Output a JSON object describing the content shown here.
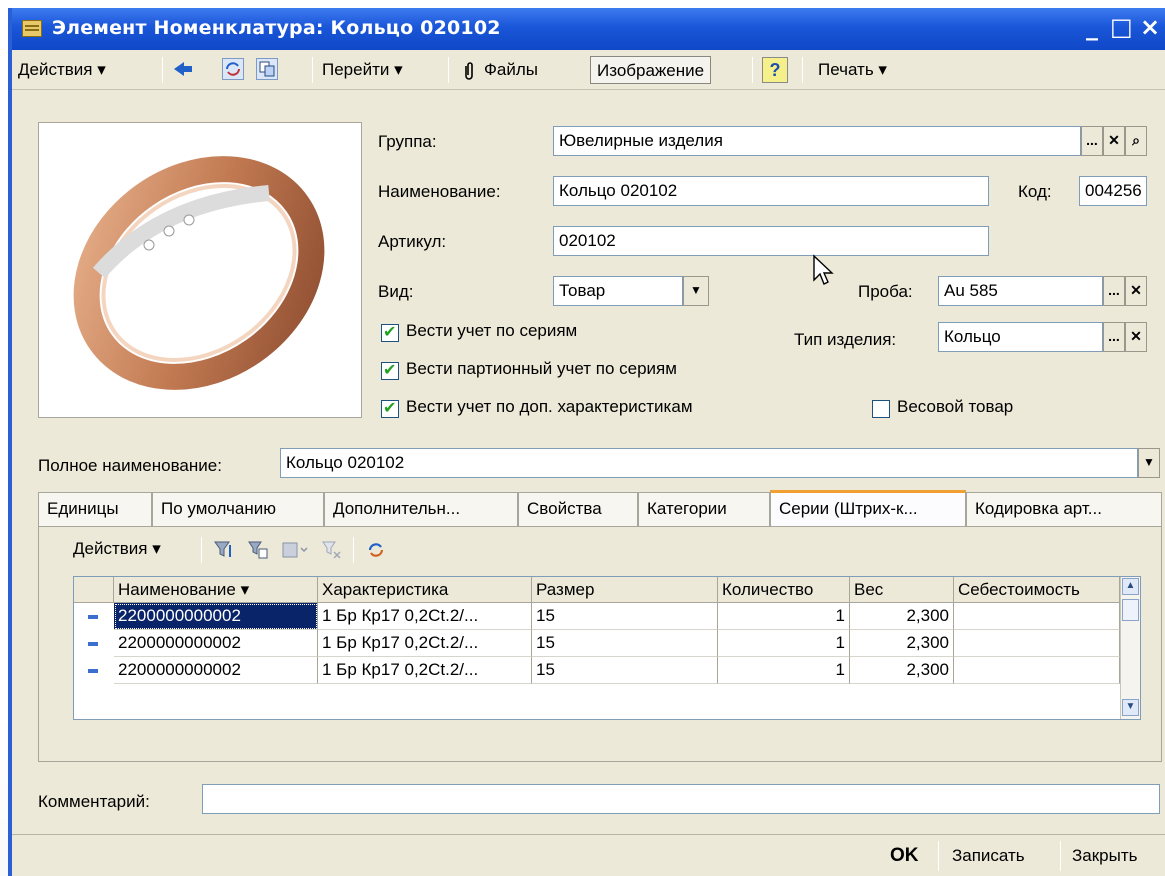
{
  "window": {
    "title": "Элемент Номенклатура: Кольцо 020102",
    "minimize": "_",
    "maximize": "□",
    "close": "×"
  },
  "toolbar": {
    "actions": "Действия ▾",
    "goto": "Перейти ▾",
    "files": "Файлы",
    "image": "Изображение",
    "help": "?",
    "print": "Печать ▾"
  },
  "form": {
    "group_label": "Группа:",
    "group_value": "Ювелирные изделия",
    "name_label": "Наименование:",
    "name_value": "Кольцо 020102",
    "code_label": "Код:",
    "code_value": "004256",
    "article_label": "Артикул:",
    "article_value": "020102",
    "kind_label": "Вид:",
    "kind_value": "Товар",
    "probe_label": "Проба:",
    "probe_value": "Au 585",
    "type_label": "Тип изделия:",
    "type_value": "Кольцо",
    "chk_series": "Вести учет по сериям",
    "chk_batch": "Вести партионный учет по сериям",
    "chk_extra": "Вести учет по доп.  характеристикам",
    "chk_weight": "Весовой товар",
    "fullname_label": "Полное наименование:",
    "fullname_value": "Кольцо 020102",
    "comment_label": "Комментарий:",
    "comment_value": ""
  },
  "tabs": [
    {
      "label": "Единицы"
    },
    {
      "label": "По умолчанию"
    },
    {
      "label": "Дополнительн..."
    },
    {
      "label": "Свойства"
    },
    {
      "label": "Категории"
    },
    {
      "label": "Серии (Штрих-к..."
    },
    {
      "label": "Кодировка арт..."
    }
  ],
  "grid": {
    "actions": "Действия ▾",
    "columns": [
      "Наименование ▾",
      "Характеристика",
      "Размер",
      "Количество",
      "Вес",
      "Себестоимость"
    ],
    "rows": [
      {
        "name": "2200000000002",
        "char": "1 Бр Кр17 0,2Ct.2/...",
        "size": "15",
        "qty": "1",
        "weight": "2,300",
        "cost": ""
      },
      {
        "name": "2200000000002",
        "char": "1 Бр Кр17 0,2Ct.2/...",
        "size": "15",
        "qty": "1",
        "weight": "2,300",
        "cost": ""
      },
      {
        "name": "2200000000002",
        "char": "1 Бр Кр17 0,2Ct.2/...",
        "size": "15",
        "qty": "1",
        "weight": "2,300",
        "cost": ""
      }
    ]
  },
  "footer": {
    "ok": "OK",
    "save": "Записать",
    "close": "Закрыть"
  }
}
